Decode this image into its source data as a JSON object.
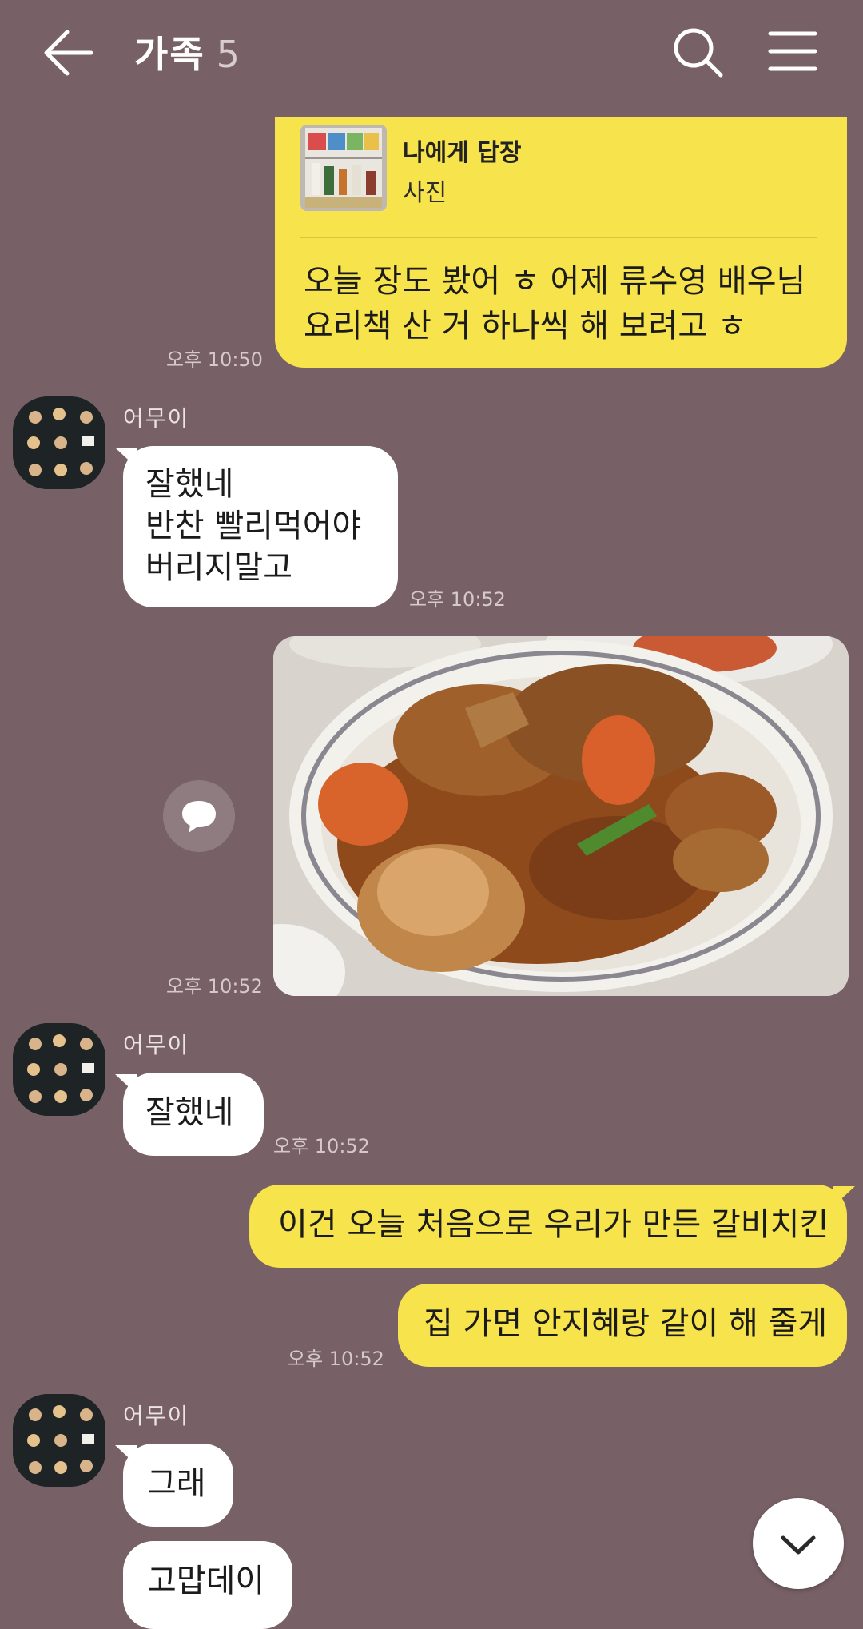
{
  "header": {
    "title": "가족",
    "member_count": "5"
  },
  "messages": {
    "m1": {
      "reply_title": "나에게 답장",
      "reply_subtitle": "사진",
      "line1": "오늘 장도 봤어 ㅎ 어제 류수영 배우님",
      "line2": "요리책 산 거 하나씩 해 보려고 ㅎ",
      "time": "오후 10:50"
    },
    "m2": {
      "sender": "어무이",
      "line1": "잘했네",
      "line2": "반찬  빨리먹어야",
      "line3": "버리지말고",
      "time": "오후 10:52"
    },
    "m3": {
      "time": "오후 10:52"
    },
    "m4": {
      "sender": "어무이",
      "text": "잘했네",
      "time": "오후 10:52"
    },
    "m5": {
      "text": "이건 오늘 처음으로 우리가 만든 갈비치킨"
    },
    "m6": {
      "text": "집 가면 안지혜랑 같이 해 줄게",
      "time": "오후 10:52"
    },
    "m7": {
      "sender": "어무이",
      "text1": "그래",
      "text2": "고맙데이"
    }
  },
  "colors": {
    "background": "#776167",
    "my_bubble": "#f7e34b",
    "other_bubble": "#ffffff"
  },
  "icons": {
    "back": "arrow-left-icon",
    "search": "search-icon",
    "menu": "hamburger-icon",
    "comment": "speech-bubble-icon",
    "scroll_down": "chevron-down-icon"
  }
}
